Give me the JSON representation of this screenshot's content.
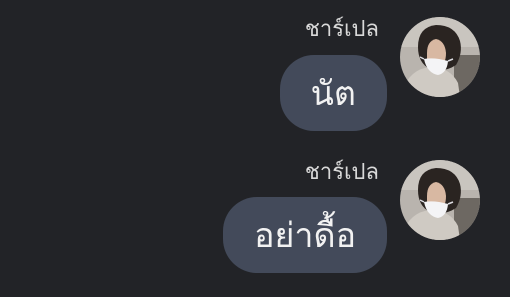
{
  "messages": [
    {
      "sender": "ชาร์เปล",
      "text": "นัต"
    },
    {
      "sender": "ชาร์เปล",
      "text": "อย่าดื้อ"
    }
  ],
  "colors": {
    "background": "#222327",
    "bubble": "#434a5a",
    "sender_text": "#d9d9d9",
    "bubble_text": "#f2f2f2"
  },
  "icons": {
    "avatar": "profile-photo-person-with-face-mask"
  }
}
